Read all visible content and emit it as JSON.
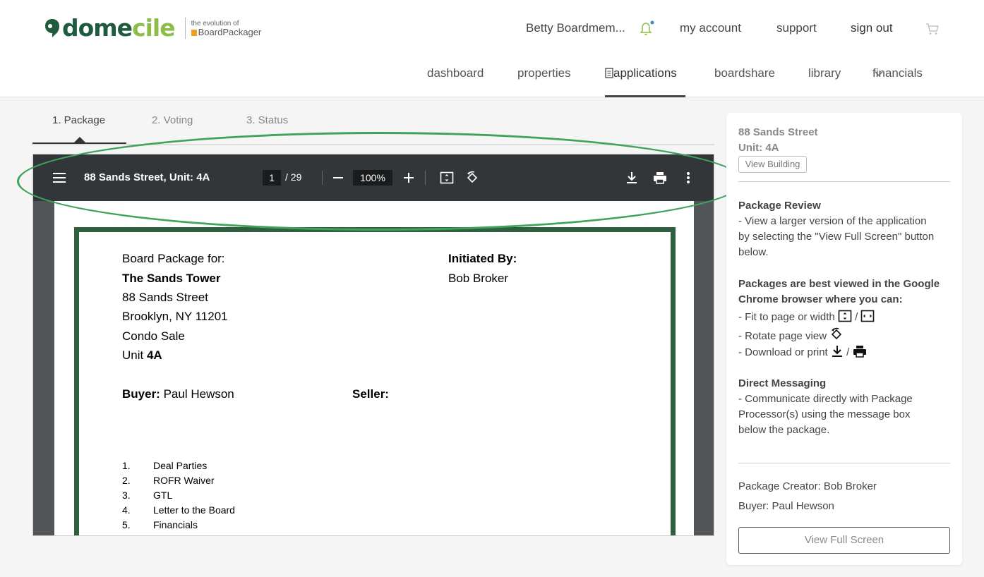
{
  "brand": {
    "name_part1": "dome",
    "name_part2": "cile",
    "tagline": "the evolution of",
    "product": "BoardPackager"
  },
  "topnav": {
    "user": "Betty Boardmem...",
    "my_account": "my account",
    "support": "support",
    "sign_out": "sign out"
  },
  "mainnav": {
    "dashboard": "dashboard",
    "properties": "properties",
    "applications": "applications",
    "boardshare": "boardshare",
    "library": "library",
    "financials": "financials"
  },
  "tabs": [
    {
      "label": "1. Package"
    },
    {
      "label": "2. Voting"
    },
    {
      "label": "3. Status"
    }
  ],
  "viewer": {
    "title": "88 Sands Street, Unit: 4A",
    "page_current": "1",
    "page_total": "/ 29",
    "zoom": "100%"
  },
  "document": {
    "board_package_for": "Board Package for:",
    "building": "The Sands Tower",
    "street": "88 Sands Street",
    "city": "Brooklyn, NY 11201",
    "type": "Condo Sale",
    "unit_label": "Unit",
    "unit": "4A",
    "initiated_by_label": "Initiated By:",
    "initiated_by": "Bob Broker",
    "buyer_label": "Buyer:",
    "buyer": "Paul Hewson",
    "seller_label": "Seller:",
    "items": [
      {
        "num": "1.",
        "text": "Deal Parties"
      },
      {
        "num": "2.",
        "text": "ROFR Waiver"
      },
      {
        "num": "3.",
        "text": "GTL"
      },
      {
        "num": "4.",
        "text": "Letter to the Board"
      },
      {
        "num": "5.",
        "text": "Financials"
      }
    ]
  },
  "sidebar": {
    "address": "88 Sands Street",
    "unit": "Unit: 4A",
    "view_building": "View Building",
    "review_title": "Package Review",
    "review_l1": "- View a larger version of the application",
    "review_l2": "by selecting the \"View Full Screen\" button",
    "review_l3": "below.",
    "best_l1": "Packages are best viewed in the Google",
    "best_l2": "Chrome browser where you can:",
    "fit": "- Fit to page or width",
    "rotate": "- Rotate page view",
    "download": "- Download or print",
    "slash": "/",
    "dm_title": "Direct Messaging",
    "dm_l1": "- Communicate directly with Package",
    "dm_l2": "Processor(s) using the message box",
    "dm_l3": "below the package.",
    "creator": "Package Creator: Bob Broker",
    "buyer": "Buyer: Paul Hewson",
    "full_screen": "View Full Screen"
  },
  "colors": {
    "brand_dark": "#1f5c3f",
    "brand_light": "#8cbd4a",
    "highlight": "#3fa35a",
    "doc_frame": "#2f5f3e",
    "toolbar": "#323639"
  }
}
